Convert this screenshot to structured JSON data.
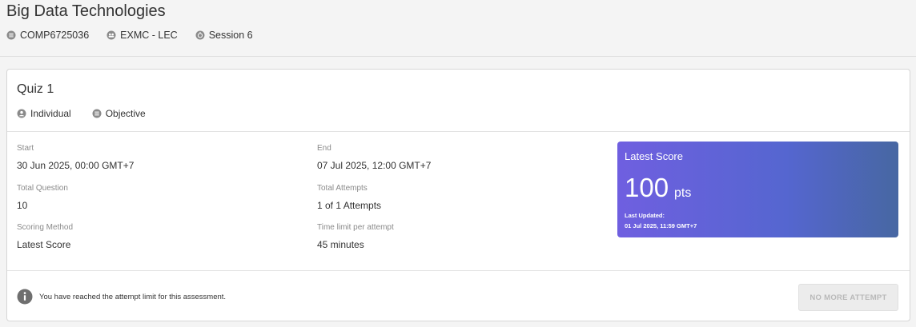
{
  "course": {
    "title": "Big Data Technologies",
    "code": "COMP6725036",
    "class": "EXMC - LEC",
    "session": "Session 6"
  },
  "quiz": {
    "title": "Quiz 1",
    "type": "Individual",
    "category": "Objective"
  },
  "details": {
    "start_label": "Start",
    "start_value": "30 Jun 2025, 00:00 GMT+7",
    "end_label": "End",
    "end_value": "07 Jul 2025, 12:00 GMT+7",
    "total_question_label": "Total Question",
    "total_question_value": "10",
    "total_attempts_label": "Total Attempts",
    "total_attempts_value": "1 of 1 Attempts",
    "scoring_method_label": "Scoring Method",
    "scoring_method_value": "Latest Score",
    "time_limit_label": "Time limit per attempt",
    "time_limit_value": "45 minutes"
  },
  "score": {
    "title": "Latest Score",
    "value": "100",
    "unit": "pts",
    "updated_label": "Last Updated:",
    "updated_value": "01 Jul 2025, 11:59 GMT+7"
  },
  "notice": {
    "text": "You have reached the attempt limit for this assessment."
  },
  "action": {
    "button_label": "NO MORE ATTEMPT"
  },
  "icons": {
    "code": "list-icon",
    "class": "group-icon",
    "session": "session-icon",
    "type": "person-icon",
    "category": "list-icon",
    "notice": "info-icon"
  },
  "colors": {
    "score_gradient_start": "#6f5fe0",
    "score_gradient_end": "#4767a2",
    "icon_gray": "#8a8a8a"
  }
}
